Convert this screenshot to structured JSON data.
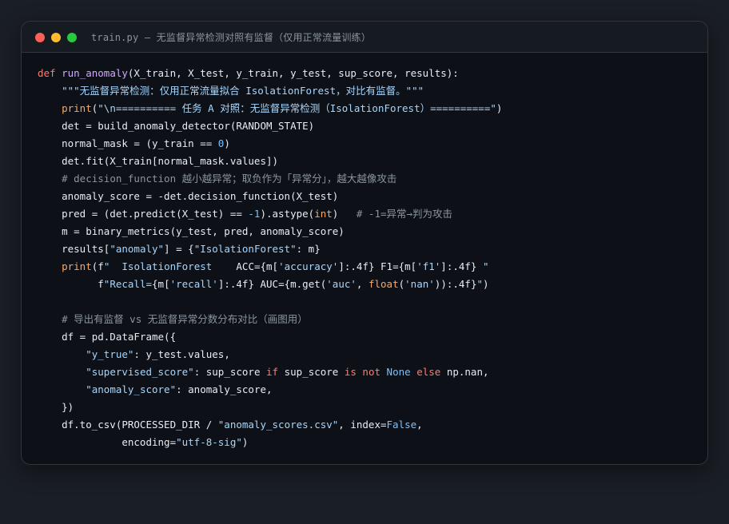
{
  "window": {
    "title": "train.py — 无监督异常检测对照有监督（仅用正常流量训练）",
    "buttons": [
      {
        "name": "close",
        "color": "#ff5f57"
      },
      {
        "name": "minimize",
        "color": "#febc2e"
      },
      {
        "name": "zoom",
        "color": "#28c840"
      }
    ]
  },
  "theme": {
    "keyword": "#ff7b72",
    "function": "#d2a8ff",
    "string": "#a5d6ff",
    "number": "#79c0ff",
    "comment": "#8b949e",
    "plain": "#e6edf3",
    "builtin": "#ffa657"
  },
  "code": {
    "lines": [
      [
        {
          "t": "kw",
          "v": "def "
        },
        {
          "t": "fn",
          "v": "run_anomaly"
        },
        {
          "t": "pl",
          "v": "(X_train, X_test, y_train, y_test, sup_score, results):"
        }
      ],
      [
        {
          "t": "pl",
          "v": "    "
        },
        {
          "t": "str",
          "v": "\"\"\"无监督异常检测：仅用正常流量拟合 IsolationForest，对比有监督。\"\"\""
        }
      ],
      [
        {
          "t": "pl",
          "v": "    "
        },
        {
          "t": "bi",
          "v": "print"
        },
        {
          "t": "pl",
          "v": "("
        },
        {
          "t": "str",
          "v": "\"\\n========== 任务 A 对照：无监督异常检测（IsolationForest）==========\""
        },
        {
          "t": "pl",
          "v": ")"
        }
      ],
      [
        {
          "t": "pl",
          "v": "    det = build_anomaly_detector(RANDOM_STATE)"
        }
      ],
      [
        {
          "t": "pl",
          "v": "    normal_mask = (y_train == "
        },
        {
          "t": "num",
          "v": "0"
        },
        {
          "t": "pl",
          "v": ")"
        }
      ],
      [
        {
          "t": "pl",
          "v": "    det.fit(X_train[normal_mask.values])"
        }
      ],
      [
        {
          "t": "pl",
          "v": "    "
        },
        {
          "t": "com",
          "v": "# decision_function 越小越异常；取负作为「异常分」，越大越像攻击"
        }
      ],
      [
        {
          "t": "pl",
          "v": "    anomaly_score = -det.decision_function(X_test)"
        }
      ],
      [
        {
          "t": "pl",
          "v": "    pred = (det.predict(X_test) == "
        },
        {
          "t": "num",
          "v": "-1"
        },
        {
          "t": "pl",
          "v": ").astype("
        },
        {
          "t": "bi",
          "v": "int"
        },
        {
          "t": "pl",
          "v": ")   "
        },
        {
          "t": "com",
          "v": "# -1=异常→判为攻击"
        }
      ],
      [
        {
          "t": "pl",
          "v": "    m = binary_metrics(y_test, pred, anomaly_score)"
        }
      ],
      [
        {
          "t": "pl",
          "v": "    results["
        },
        {
          "t": "str",
          "v": "\"anomaly\""
        },
        {
          "t": "pl",
          "v": "] = {"
        },
        {
          "t": "str",
          "v": "\"IsolationForest\""
        },
        {
          "t": "pl",
          "v": ": m}"
        }
      ],
      [
        {
          "t": "pl",
          "v": "    "
        },
        {
          "t": "bi",
          "v": "print"
        },
        {
          "t": "pl",
          "v": "(f"
        },
        {
          "t": "str",
          "v": "\"  IsolationForest    "
        },
        {
          "t": "pl",
          "v": "ACC={m["
        },
        {
          "t": "str",
          "v": "'accuracy'"
        },
        {
          "t": "pl",
          "v": "]:.4f} F1={m["
        },
        {
          "t": "str",
          "v": "'f1'"
        },
        {
          "t": "pl",
          "v": "]:.4f} "
        },
        {
          "t": "str",
          "v": "\""
        }
      ],
      [
        {
          "t": "pl",
          "v": "          f"
        },
        {
          "t": "str",
          "v": "\"Recall="
        },
        {
          "t": "pl",
          "v": "{m["
        },
        {
          "t": "str",
          "v": "'recall'"
        },
        {
          "t": "pl",
          "v": "]:.4f} AUC={m.get("
        },
        {
          "t": "str",
          "v": "'auc'"
        },
        {
          "t": "pl",
          "v": ", "
        },
        {
          "t": "bi",
          "v": "float"
        },
        {
          "t": "pl",
          "v": "("
        },
        {
          "t": "str",
          "v": "'nan'"
        },
        {
          "t": "pl",
          "v": ")):.4f}"
        },
        {
          "t": "str",
          "v": "\""
        },
        {
          "t": "pl",
          "v": ")"
        }
      ],
      [
        {
          "t": "pl",
          "v": ""
        }
      ],
      [
        {
          "t": "pl",
          "v": "    "
        },
        {
          "t": "com",
          "v": "# 导出有监督 vs 无监督异常分数分布对比（画图用）"
        }
      ],
      [
        {
          "t": "pl",
          "v": "    df = pd.DataFrame({"
        }
      ],
      [
        {
          "t": "pl",
          "v": "        "
        },
        {
          "t": "str",
          "v": "\"y_true\""
        },
        {
          "t": "pl",
          "v": ": y_test.values,"
        }
      ],
      [
        {
          "t": "pl",
          "v": "        "
        },
        {
          "t": "str",
          "v": "\"supervised_score\""
        },
        {
          "t": "pl",
          "v": ": sup_score "
        },
        {
          "t": "kw",
          "v": "if"
        },
        {
          "t": "pl",
          "v": " sup_score "
        },
        {
          "t": "kw",
          "v": "is not"
        },
        {
          "t": "pl",
          "v": " "
        },
        {
          "t": "num",
          "v": "None"
        },
        {
          "t": "pl",
          "v": " "
        },
        {
          "t": "kw",
          "v": "else"
        },
        {
          "t": "pl",
          "v": " np.nan,"
        }
      ],
      [
        {
          "t": "pl",
          "v": "        "
        },
        {
          "t": "str",
          "v": "\"anomaly_score\""
        },
        {
          "t": "pl",
          "v": ": anomaly_score,"
        }
      ],
      [
        {
          "t": "pl",
          "v": "    })"
        }
      ],
      [
        {
          "t": "pl",
          "v": "    df.to_csv(PROCESSED_DIR / "
        },
        {
          "t": "str",
          "v": "\"anomaly_scores.csv\""
        },
        {
          "t": "pl",
          "v": ", index="
        },
        {
          "t": "num",
          "v": "False"
        },
        {
          "t": "pl",
          "v": ","
        }
      ],
      [
        {
          "t": "pl",
          "v": "              encoding="
        },
        {
          "t": "str",
          "v": "\"utf-8-sig\""
        },
        {
          "t": "pl",
          "v": ")"
        }
      ]
    ]
  }
}
